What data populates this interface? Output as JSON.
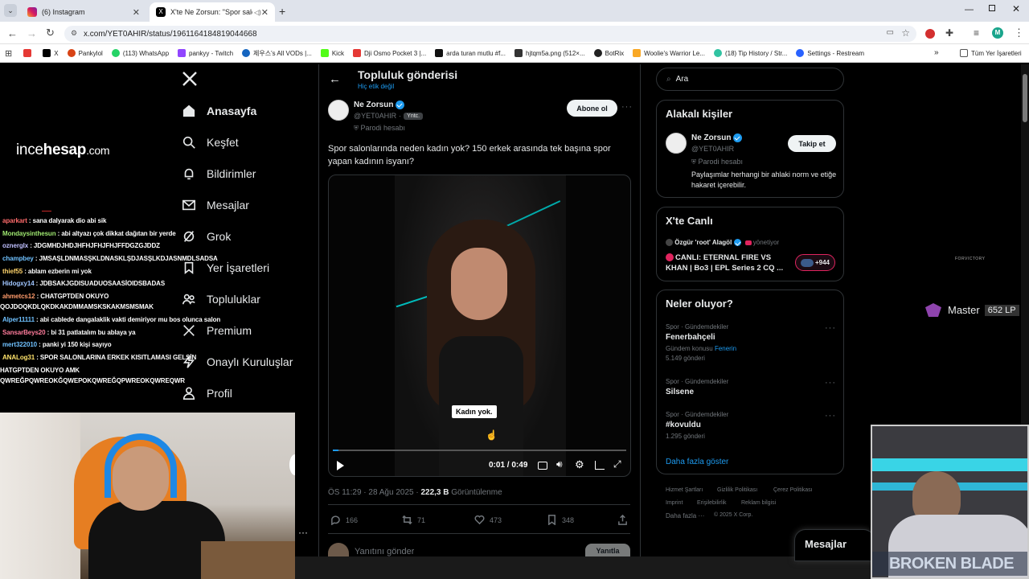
{
  "browser": {
    "tabs": [
      {
        "title": "(6) Instagram",
        "active": false
      },
      {
        "title": "X'te Ne Zorsun: \"Spor salon",
        "active": true
      }
    ],
    "url": "x.com/YET0AHIR/status/1961164184819044668",
    "bookmarks": [
      "X",
      "Pankylol",
      "(113) WhatsApp",
      "pankyy - Twitch",
      "제우스's All VODs |...",
      "Kick",
      "Dji Osmo Pocket 3 |...",
      "arda turan mutlu #f...",
      "hjtqm5a.png (512×...",
      "BotRix",
      "Woolie's Warrior Le...",
      "(18) Tip History / Str...",
      "Settings - Restream"
    ],
    "bookmarks_all": "Tüm Yer İşaretleri",
    "profile_initial": "M"
  },
  "overlay": {
    "logo_a": "ince",
    "logo_b": "hesap",
    "logo_c": ".com",
    "chat": [
      {
        "user": "aparkart",
        "msg": " : sana dalyarak dio abi sik"
      },
      {
        "user": "Mondaysinthesun",
        "msg": " : abi altyazı çok dikkat dağıtan bir yerde"
      },
      {
        "user": "oznerglx",
        "msg": " : JDGMHDJHDJHFHJFHJFHJFFDGZGJDDZ"
      },
      {
        "user": "champbey",
        "msg": " : JMSAŞLDNMASŞKLDNASKLŞDJASŞLKDJASNMDLSADSA"
      },
      {
        "user": "thief55",
        "msg": " : ablam ezberin mi yok"
      },
      {
        "user": "Hidogxy14",
        "msg": " : JDBSAKJGDISUADUOSAASİOIDSBADAS"
      },
      {
        "user": "ahmetcs12",
        "msg": " : CHATGPTDEN OKUYO"
      },
      {
        "user": "",
        "msg": "QOJDOQKDLQKDKAKDMMAMSKSKAKMSMSMAK"
      },
      {
        "user": "Alper11111",
        "msg": " : abi cablede dangalaklik vakti demiriyor mu bos olunca salon"
      },
      {
        "user": "SansarBeys20",
        "msg": " : bi 31 patlatalım bu ablaya ya"
      },
      {
        "user": "mert322010",
        "msg": " : panki yi 150 kişi sayıyo"
      },
      {
        "user": "ANALog31",
        "msg": " : SPOR SALONLARINA ERKEK KISITLAMASI GELSİN"
      },
      {
        "user": "",
        "msg": "HATGPTDEN OKUYO AMK"
      },
      {
        "user": "",
        "msg": "QWREĞPQWREOKĞQWEPOKQWREĞQPWREOKQWREQWR"
      }
    ],
    "rank_label": "Master",
    "rank_lp": "652 LP",
    "brand_small": "FORVICTORY",
    "cam2_label": "BROKEN BLADE"
  },
  "nav": {
    "items": [
      "Anasayfa",
      "Keşfet",
      "Bildirimler",
      "Mesajlar",
      "Grok",
      "Yer İşaretleri",
      "Topluluklar",
      "Premium",
      "Onaylı Kuruluşlar",
      "Profil"
    ]
  },
  "post": {
    "header_title": "Topluluk gönderisi",
    "header_sub": "Hiç etik değil",
    "author_name": "Ne Zorsun",
    "author_handle": "@YET0AHIR",
    "admin_badge": "Yntc.",
    "parody": "Parodi hesabı",
    "subscribe": "Abone ol",
    "text": "Spor salonlarında neden kadın yok? 150 erkek arasında tek başına spor yapan kadının isyanı?",
    "caption": "Kadın yok.",
    "time_current": "0:01",
    "time_total": "0:49",
    "progress": 0.02,
    "timestamp": "ÖS 11:29 · 28 Ağu 2025 · ",
    "views": "222,3 B",
    "views_label": " Görüntülenme",
    "replies": "166",
    "reposts": "71",
    "likes": "473",
    "bookmarks": "348",
    "reply_placeholder": "Yanıtını gönder",
    "reply_button": "Yanıtla"
  },
  "sidebar": {
    "search_placeholder": "Ara",
    "relevant_title": "Alakalı kişiler",
    "rel_name": "Ne Zorsun",
    "rel_handle": "@YET0AHIR",
    "rel_parody": "Parodi hesabı",
    "rel_bio": "Paylaşımlar herhangi bir ahlaki norm ve etiğe hakaret içerebilir.",
    "follow": "Takip et",
    "live_title": "X'te Canlı",
    "live_host": "Özgür 'root' Alagöl",
    "live_role": " yönetiyor",
    "live_text": "CANLI: ETERNAL FIRE VS KHAN | Bo3 | EPL Series 2 CQ ...",
    "live_count": "+944",
    "trends_title": "Neler oluyor?",
    "trends": [
      {
        "category": "Spor · Gündemdekiler",
        "name": "Fenerbahçeli",
        "meta": "Gündem konusu ",
        "meta_link": "Fenerin",
        "count": "5.149 gönderi"
      },
      {
        "category": "Spor · Gündemdekiler",
        "name": "Silsene",
        "meta": "",
        "meta_link": "",
        "count": ""
      },
      {
        "category": "Spor · Gündemdekiler",
        "name": "#kovuldu",
        "meta": "",
        "meta_link": "",
        "count": "1.295 gönderi"
      }
    ],
    "show_more": "Daha fazla göster",
    "footer": [
      "Hizmet Şartları",
      "Gizlilik Politikası",
      "Çerez Politikası",
      "Imprint",
      "Erişilebilirlik",
      "Reklam bilgisi",
      "Daha fazla ···",
      "© 2025 X Corp."
    ],
    "messages_dock": "Mesajlar"
  }
}
